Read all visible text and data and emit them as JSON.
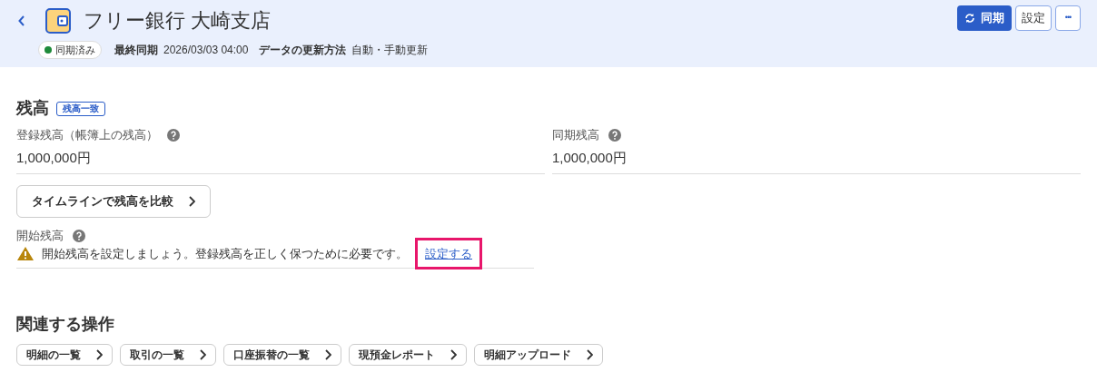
{
  "header": {
    "title": "フリー銀行 大崎支店",
    "status_badge": {
      "label": "同期済み",
      "color": "#1e8a3a"
    },
    "meta": [
      {
        "label": "最終同期",
        "value": "2026/03/03 04:00"
      },
      {
        "label": "データの更新方法",
        "value": "自動・手動更新"
      }
    ],
    "actions": [
      {
        "kind": "primary",
        "label": "同期"
      },
      {
        "kind": "outline",
        "label": "設定"
      },
      {
        "kind": "more",
        "label": "•••"
      }
    ]
  },
  "balance": {
    "title": "残高",
    "badge": "残高一致",
    "fields": [
      {
        "label": "登録残高（帳簿上の残高）",
        "value": "1,000,000円"
      },
      {
        "label": "同期残高",
        "value": "1,000,000円"
      }
    ],
    "compare_button": "タイムラインで残高を比較",
    "opening": {
      "label": "開始残高",
      "warning": "開始残高を設定しましょう。登録残高を正しく保つために必要です。",
      "link": "設定する",
      "highlighted": true
    }
  },
  "related": {
    "title": "関連する操作",
    "buttons": [
      "明細の一覧",
      "取引の一覧",
      "口座振替の一覧",
      "現預金レポート",
      "明細アップロード"
    ]
  }
}
